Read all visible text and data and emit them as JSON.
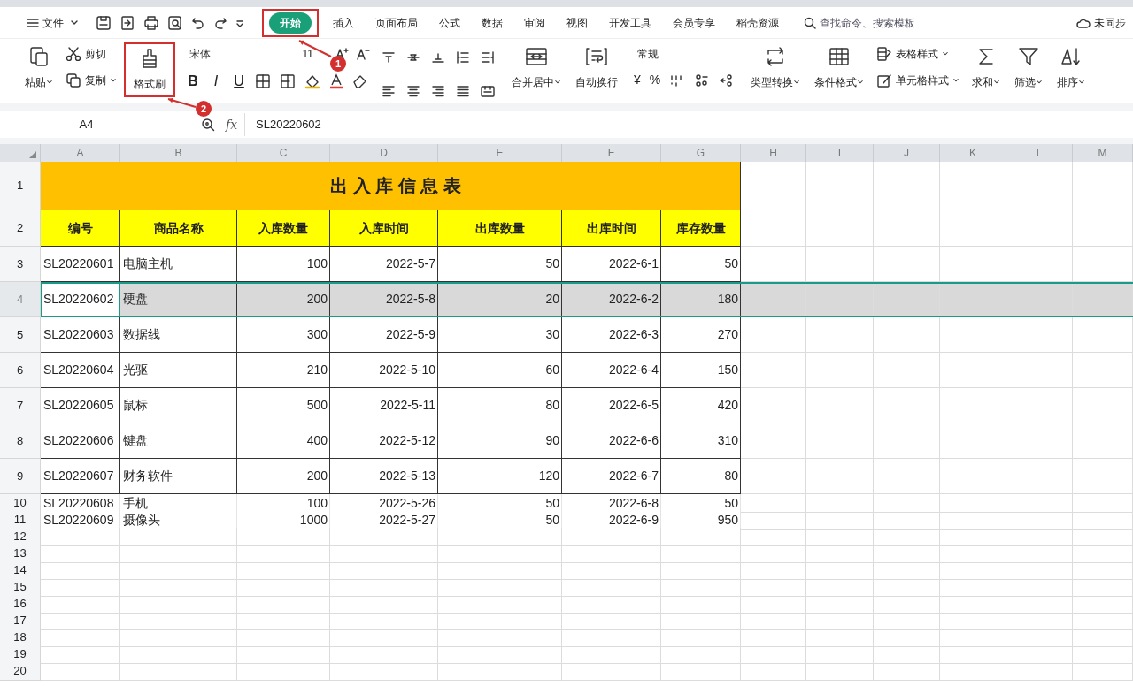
{
  "menu": {
    "label": "文件"
  },
  "tabs": [
    {
      "label": "开始",
      "selected": true,
      "highlighted": true,
      "annotation": "1"
    },
    {
      "label": "插入",
      "selected": false
    },
    {
      "label": "页面布局",
      "selected": false
    },
    {
      "label": "公式",
      "selected": false
    },
    {
      "label": "数据",
      "selected": false
    },
    {
      "label": "审阅",
      "selected": false
    },
    {
      "label": "视图",
      "selected": false
    },
    {
      "label": "开发工具",
      "selected": false
    },
    {
      "label": "会员专享",
      "selected": false
    },
    {
      "label": "稻壳资源",
      "selected": false
    }
  ],
  "search": {
    "placeholder": "查找命令、搜索模板"
  },
  "sync": {
    "label": "未同步"
  },
  "ribbon": [
    {
      "kind": "big",
      "label": "粘贴",
      "dropdown": true
    },
    {
      "kind": "stack",
      "items": [
        {
          "label": "剪切",
          "dropdown": false
        },
        {
          "label": "复制",
          "dropdown": true
        }
      ]
    },
    {
      "kind": "big",
      "label": "格式刷",
      "dropdown": false,
      "highlighted": true,
      "annotation": "2"
    },
    {
      "kind": "font",
      "font": "宋体",
      "size": "11",
      "buttons": [
        "B",
        "I",
        "U"
      ]
    },
    {
      "kind": "align"
    },
    {
      "kind": "big",
      "label": "合并居中",
      "dropdown": true
    },
    {
      "kind": "big",
      "label": "自动换行",
      "dropdown": false
    },
    {
      "kind": "number",
      "format": "常规",
      "symbols": [
        "¥",
        "%"
      ]
    },
    {
      "kind": "big",
      "label": "类型转换",
      "dropdown": true
    },
    {
      "kind": "big",
      "label": "条件格式",
      "dropdown": true
    },
    {
      "kind": "stack",
      "items": [
        {
          "label": "表格样式",
          "dropdown": true
        },
        {
          "label": "单元格样式",
          "dropdown": true
        }
      ]
    },
    {
      "kind": "big",
      "label": "求和",
      "dropdown": true
    },
    {
      "kind": "big",
      "label": "筛选",
      "dropdown": true
    },
    {
      "kind": "big",
      "label": "排序",
      "dropdown": true
    }
  ],
  "formula_bar": {
    "name_box": "A4",
    "fx": "fx",
    "value": "SL20220602"
  },
  "sheet": {
    "columns": [
      "A",
      "B",
      "C",
      "D",
      "E",
      "F",
      "G",
      "H",
      "I",
      "J",
      "K",
      "L",
      "M"
    ],
    "title_row": {
      "number": "1",
      "title": "出 入 库 信 息 表"
    },
    "header_row": {
      "number": "2",
      "cells": [
        "编号",
        "商品名称",
        "入库数量",
        "入库时间",
        "出库数量",
        "出库时间",
        "库存数量"
      ]
    },
    "rows": [
      {
        "number": "3",
        "kind": "tall",
        "selected": false,
        "cells": [
          "SL20220601",
          "电脑主机",
          "100",
          "2022-5-7",
          "50",
          "2022-6-1",
          "50"
        ]
      },
      {
        "number": "4",
        "kind": "tall",
        "selected": true,
        "cells": [
          "SL20220602",
          "硬盘",
          "200",
          "2022-5-8",
          "20",
          "2022-6-2",
          "180"
        ]
      },
      {
        "number": "5",
        "kind": "tall",
        "selected": false,
        "cells": [
          "SL20220603",
          "数据线",
          "300",
          "2022-5-9",
          "30",
          "2022-6-3",
          "270"
        ]
      },
      {
        "number": "6",
        "kind": "tall",
        "selected": false,
        "cells": [
          "SL20220604",
          "光驱",
          "210",
          "2022-5-10",
          "60",
          "2022-6-4",
          "150"
        ]
      },
      {
        "number": "7",
        "kind": "tall",
        "selected": false,
        "cells": [
          "SL20220605",
          "鼠标",
          "500",
          "2022-5-11",
          "80",
          "2022-6-5",
          "420"
        ]
      },
      {
        "number": "8",
        "kind": "tall",
        "selected": false,
        "cells": [
          "SL20220606",
          "键盘",
          "400",
          "2022-5-12",
          "90",
          "2022-6-6",
          "310"
        ]
      },
      {
        "number": "9",
        "kind": "tall",
        "selected": false,
        "cells": [
          "SL20220607",
          "财务软件",
          "200",
          "2022-5-13",
          "120",
          "2022-6-7",
          "80"
        ]
      },
      {
        "number": "10",
        "kind": "short",
        "selected": false,
        "cells": [
          "SL20220608",
          "手机",
          "100",
          "2022-5-26",
          "50",
          "2022-6-8",
          "50"
        ]
      },
      {
        "number": "11",
        "kind": "short",
        "selected": false,
        "cells": [
          "SL20220609",
          "摄像头",
          "1000",
          "2022-5-27",
          "50",
          "2022-6-9",
          "950"
        ]
      }
    ],
    "empty_rows": [
      "12",
      "13",
      "14",
      "15",
      "16",
      "17",
      "18",
      "19",
      "20"
    ]
  }
}
